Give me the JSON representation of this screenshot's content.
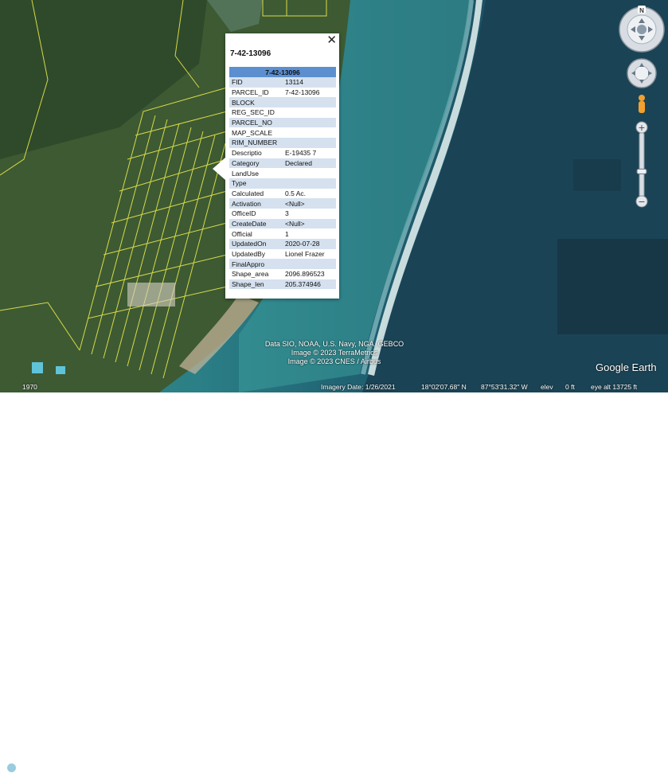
{
  "popup": {
    "title": "7-42-13096",
    "table_header": "7-42-13096",
    "close_glyph": "✕",
    "rows": [
      {
        "key": "FID",
        "value": "13114"
      },
      {
        "key": "PARCEL_ID",
        "value": "7-42-13096"
      },
      {
        "key": "BLOCK",
        "value": ""
      },
      {
        "key": "REG_SEC_ID",
        "value": ""
      },
      {
        "key": "PARCEL_NO",
        "value": ""
      },
      {
        "key": "MAP_SCALE",
        "value": ""
      },
      {
        "key": "RIM_NUMBER",
        "value": ""
      },
      {
        "key": "Descriptio",
        "value": "E-19435 7"
      },
      {
        "key": "Category",
        "value": "Declared"
      },
      {
        "key": "LandUse",
        "value": ""
      },
      {
        "key": "Type",
        "value": ""
      },
      {
        "key": "Calculated",
        "value": "0.5 Ac."
      },
      {
        "key": "Activation",
        "value": "<Null>"
      },
      {
        "key": "OfficeID",
        "value": "3"
      },
      {
        "key": "CreateDate",
        "value": "<Null>"
      },
      {
        "key": "Official",
        "value": "1"
      },
      {
        "key": "UpdatedOn",
        "value": "2020-07-28"
      },
      {
        "key": "UpdatedBy",
        "value": "Lionel Frazer"
      },
      {
        "key": "FinalAppro",
        "value": ""
      },
      {
        "key": "Shape_area",
        "value": "2096.896523"
      },
      {
        "key": "Shape_len",
        "value": "205.374946"
      }
    ]
  },
  "attribution": {
    "line1": "Data SIO, NOAA, U.S. Navy, NGA, GEBCO",
    "line2": "Image © 2023 TerraMetrics",
    "line3": "Image © 2023 CNES / Airbus"
  },
  "status_bar": {
    "year": "1970",
    "imagery_date": "Imagery Date: 1/26/2021",
    "latitude": "18°02'07.68\" N",
    "longitude": "87°53'31.32\" W",
    "elev_label": "elev",
    "elev_value": "0 ft",
    "eye_alt": "eye alt  13725 ft"
  },
  "logo": "Google Earth",
  "navigation": {
    "north_label": "N",
    "zoom_level": 0.6
  },
  "colors": {
    "header_blue": "#5b8fd0",
    "row_alt": "#d5e1ef",
    "parcel_lines": "#e8e84a",
    "deep_sea": "#1d4a5e",
    "reef_foam": "#e8f4f4"
  }
}
